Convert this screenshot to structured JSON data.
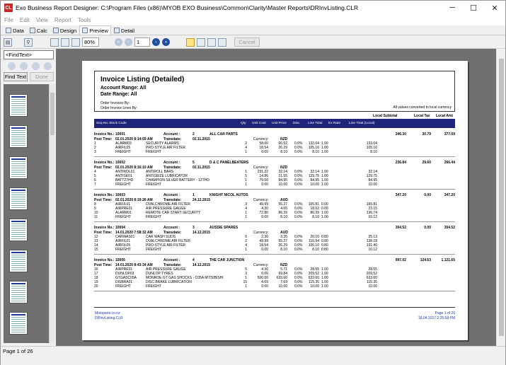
{
  "window": {
    "title": "Exo Business Report Designer: C:\\Program Files (x86)\\MYOB EXO Business\\Common\\Clarity\\Master Reports\\DRInvListing.CLR",
    "app_icon_text": "CL",
    "minimize": "─",
    "maximize": "☐",
    "close": "✕"
  },
  "menu": [
    "File",
    "Edit",
    "View",
    "Report",
    "Tools"
  ],
  "tabs": [
    "Data",
    "Calc",
    "Design",
    "Preview",
    "Detail"
  ],
  "active_tab": "Preview",
  "toolbar": {
    "zoom": "80%",
    "page": "1",
    "cancel": "Cancel"
  },
  "find": {
    "placeholder": "<FindText>",
    "find_button": "Find Text",
    "done_button": "Done"
  },
  "status": "Page 1 of 26",
  "report": {
    "title": "Invoice Listing (Detailed)",
    "account_range": "Account Range: All",
    "date_range": "Date Range: All",
    "order_invoices_by": "Order Invoices By:",
    "order_invoice_lines_by": "Order Invoice Lines By:",
    "note": "All values converted to local currency",
    "local_headers": [
      "Local Subtotal",
      "Local Tax",
      "Local Amt"
    ],
    "columns": [
      "Seq No.",
      "Stock Code",
      "Qty",
      "Unit Cost",
      "Unit Price",
      "Disc.",
      "Line Total",
      "Ex Rate",
      "Line Total (Local)"
    ],
    "invoices": [
      {
        "invoice_label": "Invoice No.:",
        "invoice_no": "10001",
        "account_label": "Account :",
        "account_no": "2",
        "account_name": "ALL CAR PARTS",
        "post_label": "Post Time:",
        "post_time": "02.01.2020 8:14:59 AM",
        "transdate_label": "Transdate:",
        "transdate": "02.11.2015",
        "currency_label": "Currency:",
        "currency": "NZD",
        "subtotal": "346.30",
        "tax": "30.79",
        "amount": "377.09",
        "lines": [
          [
            "1",
            "ALARM03",
            "SECURITY ALARMS",
            "2",
            "58.00",
            "66.52",
            "0.0%",
            "133.04",
            "1.00",
            "133.04"
          ],
          [
            "2",
            "AIRFIL05",
            "PRO-STYLE AIR FILTER",
            "4",
            "18.54",
            "26.29",
            "0.0%",
            "105.16",
            "1.00",
            "105.16"
          ],
          [
            "3",
            "FREIGHT",
            "FREIGHT",
            "1",
            "0.00",
            "8.10",
            "0.0%",
            "8.10",
            "1.00",
            "8.10"
          ]
        ]
      },
      {
        "invoice_label": "Invoice No.:",
        "invoice_no": "10002",
        "account_label": "Account :",
        "account_no": "5",
        "account_name": "D & C PANELBEATERS",
        "post_label": "Post Time:",
        "post_time": "02.01.2020 8:16:10 AM",
        "transdate_label": "Transdate:",
        "transdate": "02.11.2015",
        "currency_label": "Currency:",
        "currency": "NZD",
        "subtotal": "236.84",
        "tax": "29.60",
        "amount": "266.44",
        "lines": [
          [
            "4",
            "ANTIROL01",
            "ANTIROLL BARS",
            "1",
            "231.22",
            "32.14",
            "0.0%",
            "32.14",
            "1.00",
            "32.14"
          ],
          [
            "5",
            "ANTISE01",
            "ANTISEIZE LUBRICATOR",
            "5",
            "14.86",
            "21.55",
            "0.0%",
            "129.75",
            "1.00",
            "129.75"
          ],
          [
            "6",
            "BATT27HD",
            "CHAMPION SILVER BATTERY - 12THD",
            "1",
            "79.00",
            "84.95",
            "0.0%",
            "84.95",
            "1.00",
            "84.95"
          ],
          [
            "7",
            "FREIGHT",
            "FREIGHT",
            "1",
            "0.00",
            "10.00",
            "0.0%",
            "10.00",
            "1.00",
            "10.00"
          ]
        ]
      },
      {
        "invoice_label": "Invoice No.:",
        "invoice_no": "10003",
        "account_label": "Account :",
        "account_no": "1",
        "account_name": "KNIGHT NICOL AUTOS",
        "post_label": "Post Time:",
        "post_time": "02.01.2020 8:19:26 AM",
        "transdate_label": "Transdate:",
        "transdate": "24.12.2015",
        "currency_label": "Currency:",
        "currency": "AUD",
        "subtotal": "347.20",
        "tax": "0.00",
        "amount": "347.20",
        "lines": [
          [
            "8",
            "AIRFIL01",
            "OVALCHROME AIR FILTER",
            "3",
            "49.99",
            "55.27",
            "0.0%",
            "165.81",
            "0.00",
            "165.81"
          ],
          [
            "9",
            "AIRPRE01",
            "AIR PRESSURE GAUGE",
            "4",
            "4.30",
            "4.65",
            "0.0%",
            "18.62",
            "0.00",
            "23.15"
          ],
          [
            "10",
            "ALARM01",
            "REMOTE CAR START SECURITY",
            "1",
            "72.86",
            "86.39",
            "0.0%",
            "86.39",
            "1.00",
            "136.74"
          ],
          [
            "11",
            "FREIGHT",
            "FREIGHT",
            "1",
            "0.00",
            "8.10",
            "0.0%",
            "8.10",
            "1.00",
            "10.12"
          ]
        ]
      },
      {
        "invoice_label": "Invoice No.:",
        "invoice_no": "10004",
        "account_label": "Account :",
        "account_no": "3",
        "account_name": "AUSSIE SPARES",
        "post_label": "Post Time:",
        "post_time": "14.01.2020 7:58:32 AM",
        "transdate_label": "Transdate:",
        "transdate": "14.12.2015",
        "currency_label": "Currency:",
        "currency": "AUD",
        "subtotal": "304.52",
        "tax": "0.00",
        "amount": "304.52",
        "lines": [
          [
            "12",
            "CARWAS01",
            "CAR WASH SUDS",
            "6",
            "2.30",
            "3.35",
            "0.0%",
            "20.10",
            "0.80",
            "25.13"
          ],
          [
            "13",
            "AIRFIL01",
            "OVALCHROME AIR FILTER",
            "2",
            "49.99",
            "55.27",
            "0.0%",
            "110.54",
            "0.80",
            "138.18"
          ],
          [
            "14",
            "AIRFIL05",
            "PRO-STYLE AIR FILTER",
            "4",
            "18.54",
            "26.29",
            "0.0%",
            "105.10",
            "0.80",
            "131.40"
          ],
          [
            "15",
            "FREIGHT",
            "FREIGHT",
            "1",
            "0.00",
            "8.10",
            "0.0%",
            "8.10",
            "0.80",
            "10.12"
          ]
        ]
      },
      {
        "invoice_label": "Invoice No.:",
        "invoice_no": "10005",
        "account_label": "Account :",
        "account_no": "4",
        "account_name": "THE CAR JUNCTION",
        "post_label": "Post Time:",
        "post_time": "14.01.2020 8:43:34 AM",
        "transdate_label": "Transdate:",
        "transdate": "14.12.2015",
        "currency_label": "Currency:",
        "currency": "NZD",
        "subtotal": "997.02",
        "tax": "124.63",
        "amount": "1,121.65",
        "lines": [
          [
            "16",
            "AIRPRE01",
            "AIR PRESSURE GAUGE",
            "5",
            "4.30",
            "5.71",
            "0.0%",
            "28.55",
            "1.00",
            "28.55"
          ],
          [
            "17",
            "DUNLOP03",
            "DUNLOP TYRES",
            "3",
            "0.00",
            "69.84",
            "0.0%",
            "209.52",
            "1.00",
            "209.52"
          ],
          [
            "18",
            "GTGASC05A",
            "MONROE GT GAS SHOCKS - C05A MITSIBISHI",
            "1",
            "500.00",
            "633.60",
            "0.0%",
            "633.60",
            "1.00",
            "633.60"
          ],
          [
            "19",
            "DISBRA01",
            "DISC BRAKE LUBRICATION",
            "15",
            "4.69",
            "7.69",
            "0.0%",
            "115.35",
            "1.00",
            "115.35"
          ],
          [
            "20",
            "FREIGHT",
            "FREIGHT",
            "1",
            "0.00",
            "10.00",
            "0.0%",
            "10.00",
            "1.00",
            "10.00"
          ]
        ]
      }
    ],
    "footer": {
      "company": "Motoparts.co.nz",
      "file": "DRInvListing.CLR",
      "page": "Page 1 of 26",
      "printed": "18.04.2017 2:25:58 PM"
    }
  }
}
